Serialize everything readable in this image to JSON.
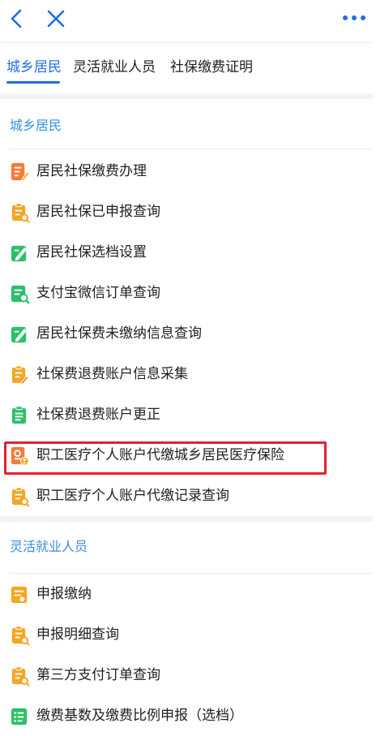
{
  "header": {
    "back_icon": "chevron-left-icon",
    "close_icon": "close-icon",
    "more_icon": "more-dots-icon",
    "icon_color": "#1e6ee6"
  },
  "tabs": [
    {
      "label": "城乡居民",
      "active": true
    },
    {
      "label": "灵活就业人员",
      "active": false
    },
    {
      "label": "社保缴费证明",
      "active": false
    }
  ],
  "sections": [
    {
      "title": "城乡居民",
      "items": [
        {
          "label": "居民社保缴费办理",
          "icon": "form-pen-icon",
          "color": "#f47b3a"
        },
        {
          "label": "居民社保已申报查询",
          "icon": "clipboard-search-icon",
          "color": "#f5a623"
        },
        {
          "label": "居民社保选档设置",
          "icon": "edit-settings-icon",
          "color": "#2dbf6a"
        },
        {
          "label": "支付宝微信订单查询",
          "icon": "order-search-icon",
          "color": "#2dbf6a"
        },
        {
          "label": "居民社保费未缴纳信息查询",
          "icon": "edit-settings-icon",
          "color": "#2dbf6a"
        },
        {
          "label": "社保费退费账户信息采集",
          "icon": "clipboard-edit-icon",
          "color": "#f5a623"
        },
        {
          "label": "社保费退费账户更正",
          "icon": "clipboard-check-icon",
          "color": "#2dbf6a"
        },
        {
          "label": "职工医疗个人账户代缴城乡居民医疗保险",
          "icon": "document-person-icon",
          "color": "#f47b3a",
          "highlighted": true
        },
        {
          "label": "职工医疗个人账户代缴记录查询",
          "icon": "clipboard-search-icon",
          "color": "#f5a623"
        }
      ]
    },
    {
      "title": "灵活就业人员",
      "items": [
        {
          "label": "申报缴纳",
          "icon": "payment-card-icon",
          "color": "#f5a623"
        },
        {
          "label": "申报明细查询",
          "icon": "clipboard-search-icon",
          "color": "#f5a623"
        },
        {
          "label": "第三方支付订单查询",
          "icon": "clipboard-search-icon",
          "color": "#f5a623"
        },
        {
          "label": "缴费基数及缴费比例申报（选档）",
          "icon": "list-form-icon",
          "color": "#2dbf6a"
        }
      ]
    }
  ],
  "highlight_color": "#e0232e"
}
